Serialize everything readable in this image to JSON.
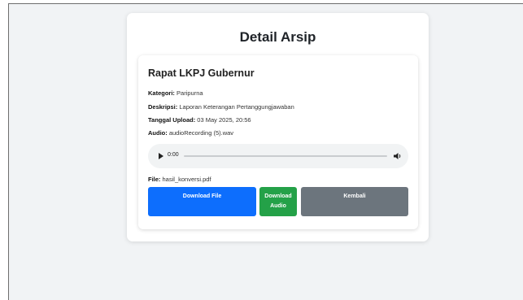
{
  "page": {
    "title": "Detail Arsip"
  },
  "archive": {
    "title": "Rapat LKPJ Gubernur",
    "fields": {
      "kategori": {
        "label": "Kategori:",
        "value": "Paripurna"
      },
      "deskripsi": {
        "label": "Deskripsi:",
        "value": "Laporan Keterangan Pertanggungjawaban"
      },
      "tanggal": {
        "label": "Tanggal Upload:",
        "value": "03 May 2025, 20:56"
      },
      "audio": {
        "label": "Audio:",
        "value": "audioRecording (5).wav"
      },
      "file": {
        "label": "File:",
        "value": "hasil_konversi.pdf"
      }
    }
  },
  "player": {
    "current_time": "0:00",
    "progress": 0,
    "icons": {
      "play": "play-icon",
      "volume": "volume-icon"
    }
  },
  "buttons": {
    "download_file": "Download File",
    "download_audio": "Download Audio",
    "back": "Kembali"
  },
  "colors": {
    "primary": "#0d6efd",
    "success": "#24a148",
    "secondary": "#6c757d",
    "background": "#f1f3f5"
  }
}
